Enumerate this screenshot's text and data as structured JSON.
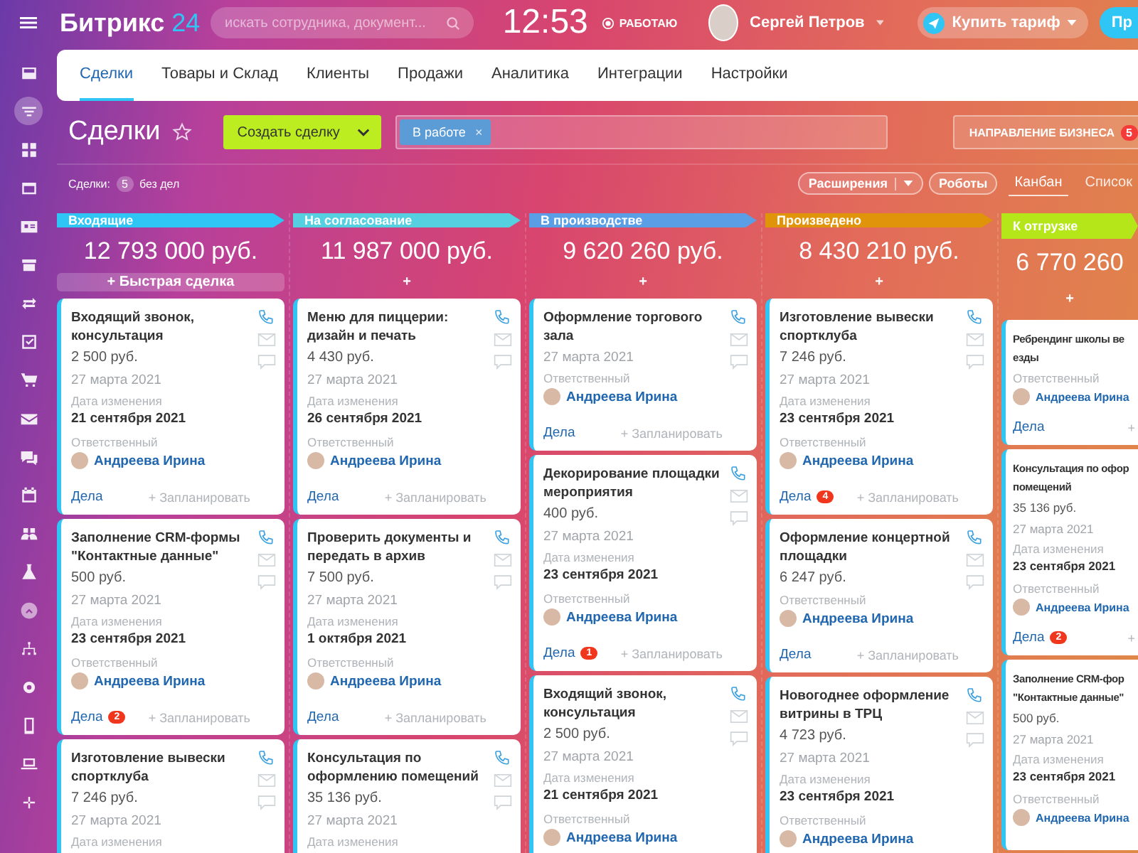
{
  "top_bar": {
    "logo": {
      "name": "Битрикс",
      "number": "24"
    },
    "search": {
      "placeholder": "искать сотрудника, документ..."
    },
    "time": "12:53",
    "status": "РАБОТАЮ",
    "user": "Сергей Петров",
    "buy_button": "Купить тариф",
    "extra_button": "Пр"
  },
  "sidebar": {
    "items": [
      {
        "kind": "tray",
        "selected": false
      },
      {
        "kind": "filter",
        "selected": true
      },
      {
        "kind": "grid",
        "selected": false
      },
      {
        "kind": "window",
        "selected": false
      },
      {
        "kind": "contact",
        "selected": false
      },
      {
        "kind": "store",
        "selected": false
      },
      {
        "kind": "sync",
        "selected": false
      },
      {
        "kind": "tasks",
        "selected": false
      },
      {
        "kind": "cart",
        "selected": false
      },
      {
        "kind": "mail",
        "selected": false
      },
      {
        "kind": "chat",
        "selected": false
      },
      {
        "kind": "calendar",
        "selected": false
      },
      {
        "kind": "people",
        "selected": false
      },
      {
        "kind": "flask",
        "selected": false
      },
      {
        "kind": "up",
        "selected": false
      },
      {
        "kind": "sitemap",
        "selected": false
      },
      {
        "kind": "gear",
        "selected": false
      },
      {
        "kind": "phone",
        "selected": false
      },
      {
        "kind": "laptop",
        "selected": false
      },
      {
        "kind": "plus",
        "selected": false
      }
    ]
  },
  "tabs": [
    {
      "label": "Сделки",
      "selected": true
    },
    {
      "label": "Товары и Склад",
      "selected": false
    },
    {
      "label": "Клиенты",
      "selected": false
    },
    {
      "label": "Продажи",
      "selected": false
    },
    {
      "label": "Аналитика",
      "selected": false
    },
    {
      "label": "Интеграции",
      "selected": false
    },
    {
      "label": "Настройки",
      "selected": false
    }
  ],
  "toolbar": {
    "title": "Сделки",
    "create_button": "Создать сделку",
    "filter_tag": "В работе",
    "filter_tag_close": "×",
    "direction_button": "НАПРАВЛЕНИЕ БИЗНЕСА",
    "direction_badge": "5"
  },
  "summary": {
    "label": "Сделки:",
    "count": "5",
    "suffix": "без дел"
  },
  "view_controls": {
    "extensions": "Расширения",
    "robots": "Роботы",
    "views": [
      {
        "label": "Канбан",
        "selected": true
      },
      {
        "label": "Список",
        "selected": false
      }
    ]
  },
  "columns": [
    {
      "name": "Входящие",
      "color": "#2fc6f6",
      "amount": "12 793 000 руб.",
      "add": {
        "label": "+ Быстрая сделка",
        "highlighted": true
      },
      "cards": [
        {
          "title": "Входящий звонок, консультация",
          "amount": "2 500 руб.",
          "date": "27 марта 2021",
          "changed_label": "Дата изменения",
          "changed_date": "21 сентября 2021",
          "responsible_label": "Ответственный",
          "person": "Андреева Ирина",
          "tasks": "Дела",
          "plan": "+ Запланировать"
        },
        {
          "title": "Заполнение CRM-формы \"Контактные данные\"",
          "amount": "500 руб.",
          "date": "27 марта 2021",
          "changed_label": "Дата изменения",
          "changed_date": "23 сентября 2021",
          "responsible_label": "Ответственный",
          "person": "Андреева Ирина",
          "tasks": "Дела",
          "badge": "2",
          "plan": "+ Запланировать"
        },
        {
          "title": "Изготовление вывески спортклуба",
          "amount": "7 246 руб.",
          "date": "27 марта 2021",
          "changed_label": "Дата изменения"
        }
      ]
    },
    {
      "name": "На согласование",
      "color": "#55d0e0",
      "amount": "11 987 000 руб.",
      "add": {
        "label": "+",
        "highlighted": false
      },
      "cards": [
        {
          "title": "Меню для пиццерии: дизайн и печать",
          "amount": "4 430 руб.",
          "date": "27 марта 2021",
          "changed_label": "Дата изменения",
          "changed_date": "26 сентября 2021",
          "responsible_label": "Ответственный",
          "person": "Андреева Ирина",
          "tasks": "Дела",
          "plan": "+ Запланировать"
        },
        {
          "title": "Проверить документы и передать в архив",
          "amount": "7 500 руб.",
          "date": "27 марта 2021",
          "changed_label": "Дата изменения",
          "changed_date": "1 октября 2021",
          "responsible_label": "Ответственный",
          "person": "Андреева Ирина",
          "tasks": "Дела",
          "plan": "+ Запланировать"
        },
        {
          "title": "Консультация по оформлению помещений",
          "amount": "35 136 руб.",
          "date": "27 марта 2021",
          "changed_label": "Дата изменения"
        }
      ]
    },
    {
      "name": "В производстве",
      "color": "#5a9fe6",
      "amount": "9 620 260 руб.",
      "add": {
        "label": "+",
        "highlighted": false
      },
      "cards": [
        {
          "title": "Оформление торгового зала",
          "date": "27 марта 2021",
          "responsible_label": "Ответственный",
          "person": "Андреева Ирина",
          "tasks": "Дела",
          "plan": "+ Запланировать"
        },
        {
          "title": "Декорирование площадки мероприятия",
          "amount": "400 руб.",
          "date": "27 марта 2021",
          "changed_label": "Дата изменения",
          "changed_date": "23 сентября 2021",
          "responsible_label": "Ответственный",
          "person": "Андреева Ирина",
          "tasks": "Дела",
          "badge": "1",
          "plan": "+ Запланировать"
        },
        {
          "title": "Входящий звонок, консультация",
          "amount": "2 500 руб.",
          "date": "27 марта 2021",
          "changed_label": "Дата изменения",
          "changed_date": "21 сентября 2021",
          "responsible_label": "Ответственный",
          "person": "Андреева Ирина"
        }
      ]
    },
    {
      "name": "Произведено",
      "color": "#e0940a",
      "amount": "8 430 210 руб.",
      "add": {
        "label": "+",
        "highlighted": false
      },
      "cards": [
        {
          "title": "Изготовление вывески спортклуба",
          "amount": "7 246 руб.",
          "date": "27 марта 2021",
          "changed_label": "Дата изменения",
          "changed_date": "23 сентября 2021",
          "responsible_label": "Ответственный",
          "person": "Андреева Ирина",
          "tasks": "Дела",
          "badge": "4",
          "plan": "+ Запланировать"
        },
        {
          "title": "Оформление концертной площадки",
          "amount": "6 247 руб.",
          "responsible_label": "Ответственный",
          "person": "Андреева Ирина",
          "tasks": "Дела",
          "plan": "+ Запланировать"
        },
        {
          "title": "Новогоднее оформление витрины в ТРЦ",
          "amount": "4 723 руб.",
          "date": "27 марта 2021",
          "changed_label": "Дата изменения",
          "changed_date": "23 сентября 2021",
          "responsible_label": "Ответственный",
          "person": "Андреева Ирина"
        }
      ]
    },
    {
      "name": "К отгрузке",
      "color": "#b5e61a",
      "amount": "6 770 260",
      "add": {
        "label": "+",
        "highlighted": false
      },
      "cards": [
        {
          "title": "Ребрендинг школы ве\nезды",
          "responsible_label": "Ответственный",
          "person": "Андреева Ирина",
          "tasks": "Дела",
          "plan": "+"
        },
        {
          "title": "Консультация по офор\nпомещений",
          "amount": "35 136 руб.",
          "date": "27 марта 2021",
          "changed_label": "Дата изменения",
          "changed_date": "23 сентября 2021",
          "responsible_label": "Ответственный",
          "person": "Андреева Ирина",
          "tasks": "Дела",
          "badge": "2",
          "plan": "+"
        },
        {
          "title": "Заполнение CRM-фор\n\"Контактные данные\"",
          "amount": "500 руб.",
          "date": "27 марта 2021",
          "changed_label": "Дата изменения",
          "changed_date": "23 сентября 2021",
          "responsible_label": "Ответственный",
          "person": "Андреева Ирина"
        }
      ]
    }
  ]
}
